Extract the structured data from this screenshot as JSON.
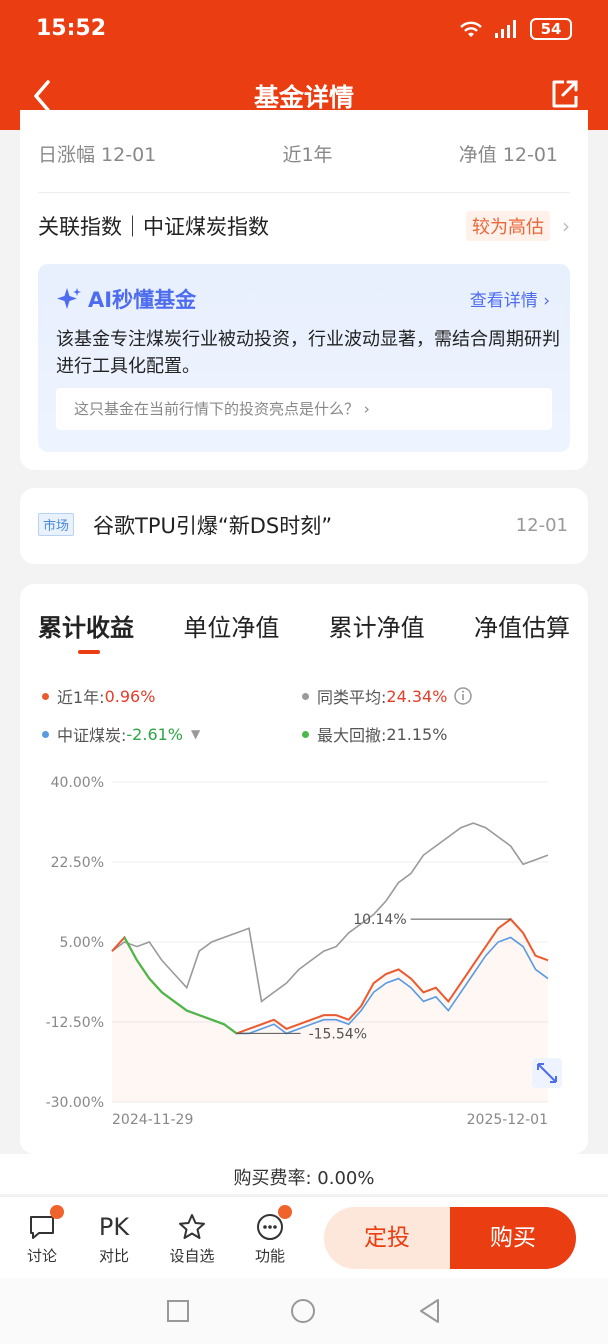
{
  "status_bar": {
    "time": "15:52",
    "battery": "54"
  },
  "header": {
    "title": "基金详情"
  },
  "stats": {
    "daily_label": "日涨幅 12-01",
    "period_label": "近1年",
    "nav_label": "净值 12-01"
  },
  "index": {
    "label": "关联指数｜中证煤炭指数",
    "valuation": "较为高估"
  },
  "ai": {
    "title": "AI秒懂基金",
    "more": "查看详情",
    "body": "该基金专注煤炭行业被动投资，行业波动显著，需结合周期研判进行工具化配置。",
    "question": "这只基金在当前行情下的投资亮点是什么？"
  },
  "news": {
    "tag": "市场",
    "title": "谷歌TPU引爆“新DS时刻”",
    "date": "12-01"
  },
  "chart_tabs": [
    "累计收益",
    "单位净值",
    "累计净值",
    "净值估算"
  ],
  "legend": {
    "fund_label": "近1年:",
    "fund_value": "0.96%",
    "peer_label": "同类平均:",
    "peer_value": "24.34%",
    "index_label": "中证煤炭:",
    "index_value": "-2.61%",
    "drawdown_label": "最大回撤:",
    "drawdown_value": "21.15%"
  },
  "colors": {
    "fund": "#ea5a2e",
    "peer": "#9a9a9a",
    "index": "#5a9be0",
    "drawdown": "#4cb84c",
    "accent": "#ea3d12"
  },
  "chart_data": {
    "type": "line",
    "x_ticks": [
      "2024-11-29",
      "2025-12-01"
    ],
    "y_ticks": [
      "40.00%",
      "22.50%",
      "5.00%",
      "-12.50%",
      "-30.00%"
    ],
    "ylim": [
      -30,
      40
    ],
    "annotations": [
      "10.14%",
      "-15.54%"
    ],
    "series": [
      {
        "name": "近1年",
        "values": [
          3,
          6,
          1,
          -3,
          -6,
          -8,
          -10,
          -11,
          -12,
          -13,
          -15,
          -14,
          -13,
          -12,
          -14,
          -13,
          -12,
          -11,
          -11,
          -12,
          -9,
          -4,
          -2,
          -1,
          -3,
          -6,
          -5,
          -8,
          -4,
          0,
          4,
          8,
          10,
          7,
          2,
          1
        ]
      },
      {
        "name": "同类平均",
        "values": [
          3,
          5,
          4,
          5,
          1,
          -2,
          -5,
          3,
          5,
          6,
          7,
          8,
          -8,
          -6,
          -4,
          -1,
          1,
          3,
          4,
          7,
          9,
          11,
          14,
          18,
          20,
          24,
          26,
          28,
          30,
          31,
          30,
          28,
          26,
          22,
          23,
          24
        ]
      },
      {
        "name": "中证煤炭",
        "values": [
          3,
          6,
          1,
          -3,
          -6,
          -8,
          -10,
          -11,
          -12,
          -13,
          -15,
          -15,
          -14,
          -13,
          -15,
          -14,
          -13,
          -12,
          -12,
          -13,
          -10,
          -6,
          -4,
          -3,
          -5,
          -8,
          -7,
          -10,
          -6,
          -2,
          2,
          5,
          6,
          4,
          -1,
          -3
        ]
      }
    ]
  },
  "bottom": {
    "fee": "购买费率: 0.00%",
    "discuss": "讨论",
    "pk_icon": "PK",
    "pk": "对比",
    "watch": "设自选",
    "more": "功能",
    "sip": "定投",
    "buy": "购买"
  }
}
